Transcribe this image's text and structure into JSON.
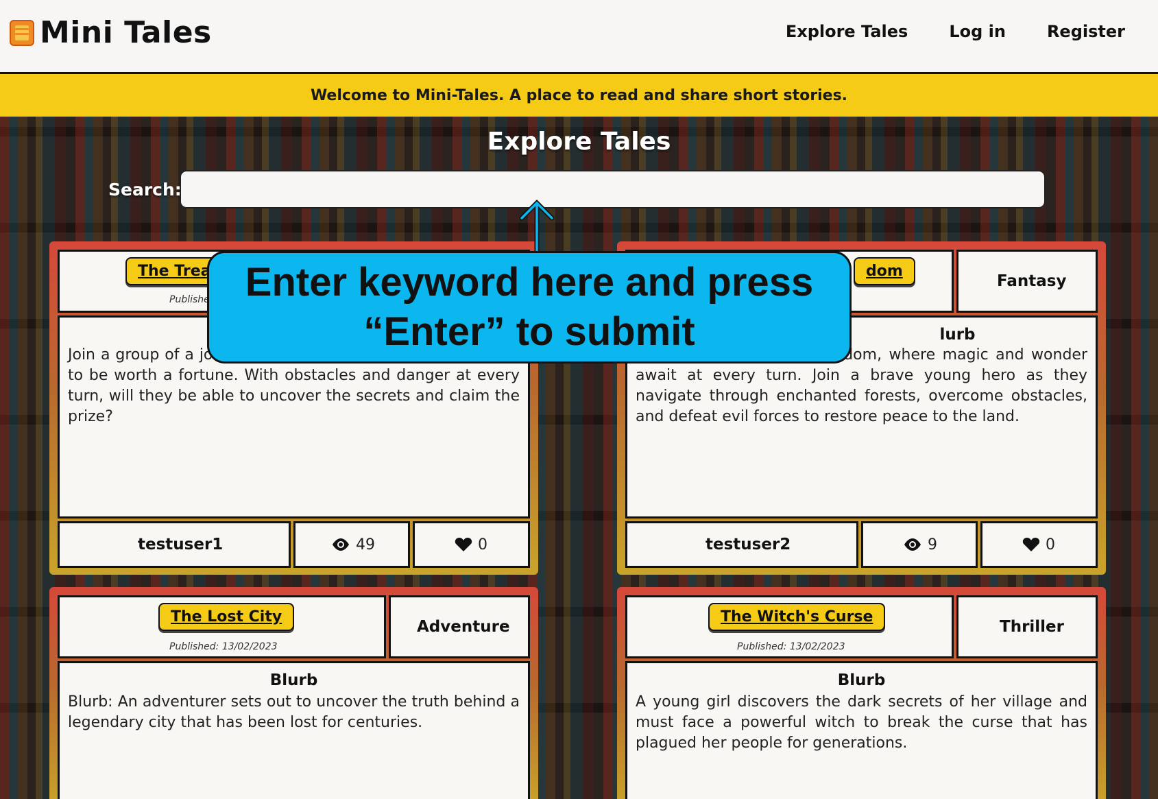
{
  "header": {
    "brand": "Mini Tales",
    "nav": [
      "Explore Tales",
      "Log in",
      "Register"
    ]
  },
  "banner": "Welcome to Mini-Tales. A place to read and share short stories.",
  "main": {
    "title": "Explore Tales",
    "search": {
      "label": "Search:",
      "value": "",
      "placeholder": ""
    }
  },
  "cards": [
    {
      "title": "The Trea",
      "published": "Publishe",
      "genre": "",
      "blurb_heading": "",
      "blurb": "Join a group of a journey to uncover a hidden treasure said to be worth a fortune. With obstacles and danger at every turn, will they be able to uncover the secrets and claim the prize?",
      "author": "testuser1",
      "views": "49",
      "likes": "0"
    },
    {
      "title": "dom",
      "published": "",
      "genre": "Fantasy",
      "blurb_heading": "lurb",
      "blurb": "e mystical Enchanted Kingdom, where magic and wonder await at every turn. Join a brave young hero as they navigate through enchanted forests, overcome obstacles, and defeat evil forces to restore peace to the land.",
      "author": "testuser2",
      "views": "9",
      "likes": "0"
    },
    {
      "title": "The Lost City",
      "published": "Published: 13/02/2023",
      "genre": "Adventure",
      "blurb_heading": "Blurb",
      "blurb": "Blurb: An adventurer sets out to uncover the truth behind a legendary city that has been lost for centuries."
    },
    {
      "title": "The Witch's Curse",
      "published": "Published: 13/02/2023",
      "genre": "Thriller",
      "blurb_heading": "Blurb",
      "blurb": "A young girl discovers the dark secrets of her village and must face a powerful witch to break the curse that has plagued her people for generations."
    }
  ],
  "callout": {
    "line1": "Enter keyword here and press",
    "line2": "“Enter” to submit"
  },
  "colors": {
    "banner": "#f6cb16",
    "callout": "#0bb7ee",
    "title_button": "#f6cb16"
  }
}
